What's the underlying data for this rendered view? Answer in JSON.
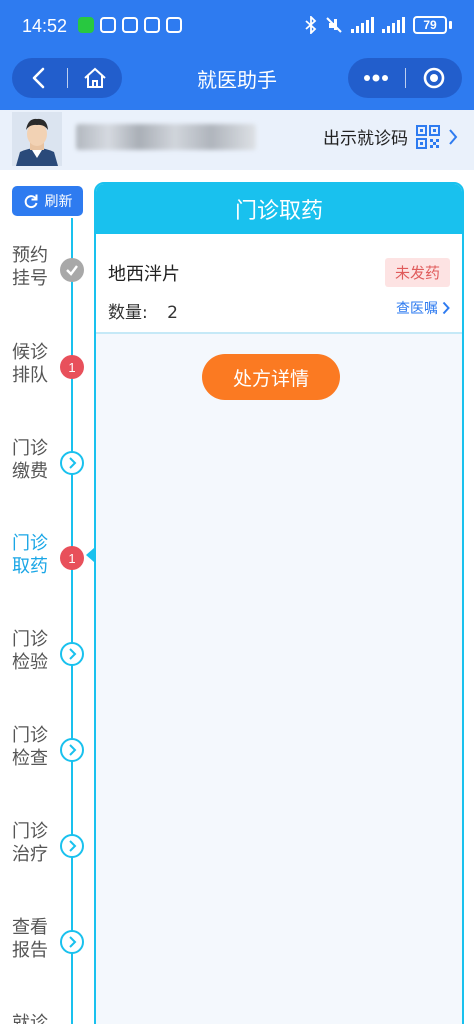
{
  "status_bar": {
    "time": "14:52",
    "battery": "79"
  },
  "nav": {
    "title": "就医助手"
  },
  "patient": {
    "show_code_label": "出示就诊码"
  },
  "refresh_label": "刷新",
  "steps": [
    {
      "label": "预约挂号",
      "marker": "done",
      "badge": ""
    },
    {
      "label": "候诊排队",
      "marker": "badge",
      "badge": "1"
    },
    {
      "label": "门诊缴费",
      "marker": "arrow",
      "badge": ""
    },
    {
      "label": "门诊取药",
      "marker": "badge",
      "badge": "1",
      "active": true
    },
    {
      "label": "门诊检验",
      "marker": "arrow",
      "badge": ""
    },
    {
      "label": "门诊检查",
      "marker": "arrow",
      "badge": ""
    },
    {
      "label": "门诊治疗",
      "marker": "arrow",
      "badge": ""
    },
    {
      "label": "查看报告",
      "marker": "arrow",
      "badge": ""
    },
    {
      "label": "就诊",
      "marker": "arrow",
      "badge": ""
    }
  ],
  "panel": {
    "title": "门诊取药",
    "drug": {
      "name": "地西泮片",
      "qty_label": "数量:",
      "qty_value": "2",
      "status": "未发药",
      "view_order": "查医嘱"
    },
    "prescription_button": "处方详情"
  },
  "colors": {
    "nav_blue": "#2e7bf0",
    "cyan": "#19c1ee",
    "orange": "#fb7a22",
    "badge_red": "#e8505b"
  }
}
